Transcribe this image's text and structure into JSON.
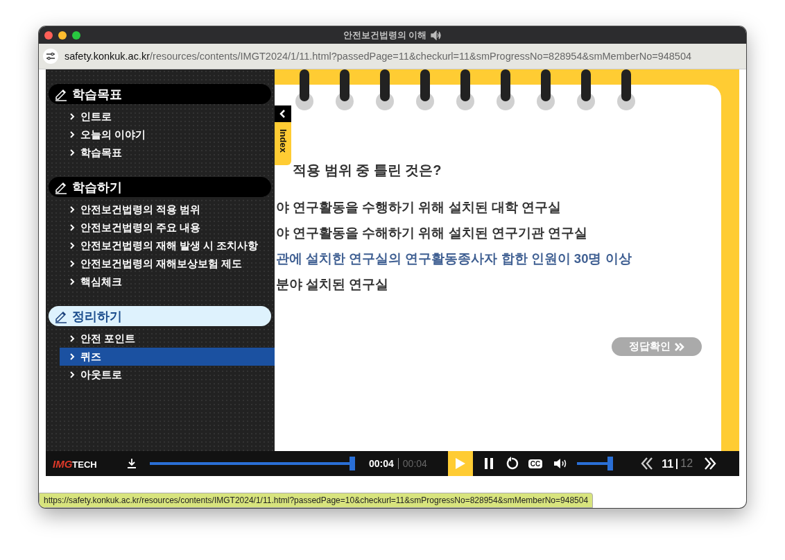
{
  "window": {
    "title": "안전보건법령의 이해"
  },
  "address_bar": {
    "url_host": "safety.konkuk.ac.kr",
    "url_path": "/resources/contents/IMGT2024/1/11.html?passedPage=11&checkurl=11&smProgressNo=828954&smMemberNo=948504"
  },
  "sidebar": {
    "sections": [
      {
        "title": "학습목표",
        "selected": false,
        "items": [
          {
            "label": "인트로",
            "selected": false
          },
          {
            "label": "오늘의 이야기",
            "selected": false
          },
          {
            "label": "학습목표",
            "selected": false
          }
        ]
      },
      {
        "title": "학습하기",
        "selected": false,
        "items": [
          {
            "label": "안전보건법령의 적용 범위",
            "selected": false
          },
          {
            "label": "안전보건법령의 주요 내용",
            "selected": false
          },
          {
            "label": "안전보건법령의 재해 발생 시 조치사항",
            "selected": false
          },
          {
            "label": "안전보건법령의 재해보상보험 제도",
            "selected": false
          },
          {
            "label": "핵심체크",
            "selected": false
          }
        ]
      },
      {
        "title": "정리하기",
        "selected": true,
        "items": [
          {
            "label": "안전 포인트",
            "selected": false
          },
          {
            "label": "퀴즈",
            "selected": true
          },
          {
            "label": "아웃트로",
            "selected": false
          }
        ]
      }
    ]
  },
  "index_tab": {
    "label": "Index"
  },
  "quiz": {
    "question": "적용 범위 중 틀린 것은?",
    "options": [
      {
        "text": "야 연구활동을 수행하기 위해 설치된 대학 연구실",
        "selected": false
      },
      {
        "text": "야 연구활동을 수해하기 위해 설치된 연구기관 연구실",
        "selected": false
      },
      {
        "text": "관에 설치한 연구실의 연구활동종사자 합한 인원이 30명 이상",
        "selected": true
      },
      {
        "text": "분야 설치된 연구실",
        "selected": false
      }
    ],
    "check_button": "정답확인"
  },
  "player": {
    "logo_primary": "IMG",
    "logo_secondary": "TECH",
    "progress": {
      "level": 1
    },
    "current_time": "00:04",
    "total_time": "00:04",
    "cc_label": "CC",
    "volume": {
      "level": 1
    },
    "current_page": "11",
    "total_pages": "12"
  },
  "status_bar": {
    "url": "https://safety.konkuk.ac.kr/resources/contents/IMGT2024/1/11.html?passedPage=10&checkurl=11&smProgressNo=828954&smMemberNo=948504"
  }
}
